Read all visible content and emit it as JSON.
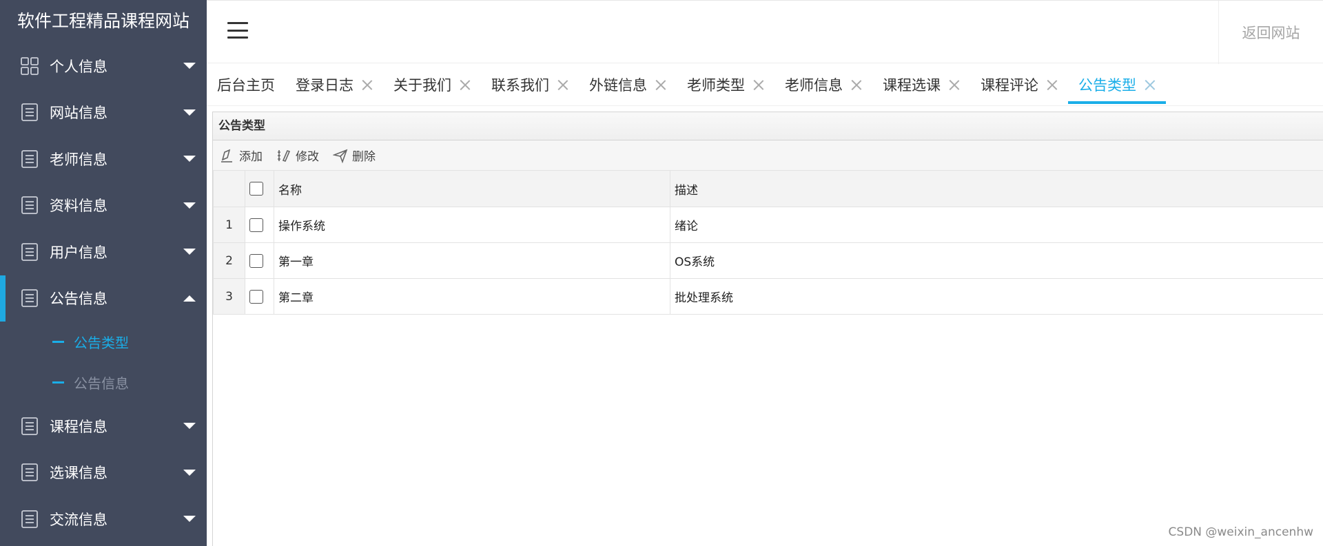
{
  "app": {
    "title": "软件工程精品课程网站"
  },
  "sidebar": {
    "items": [
      {
        "label": "个人信息",
        "icon": "grid-icon",
        "expanded": false
      },
      {
        "label": "网站信息",
        "icon": "list-icon",
        "expanded": false
      },
      {
        "label": "老师信息",
        "icon": "list-icon",
        "expanded": false
      },
      {
        "label": "资料信息",
        "icon": "list-icon",
        "expanded": false
      },
      {
        "label": "用户信息",
        "icon": "list-icon",
        "expanded": false
      },
      {
        "label": "公告信息",
        "icon": "list-icon",
        "expanded": true,
        "children": [
          {
            "label": "公告类型",
            "active": true
          },
          {
            "label": "公告信息",
            "active": false
          }
        ]
      },
      {
        "label": "课程信息",
        "icon": "list-icon",
        "expanded": false
      },
      {
        "label": "选课信息",
        "icon": "list-icon",
        "expanded": false
      },
      {
        "label": "交流信息",
        "icon": "list-icon",
        "expanded": false
      }
    ]
  },
  "header": {
    "back_label": "返回网站"
  },
  "tabs": [
    {
      "label": "后台主页",
      "closable": false
    },
    {
      "label": "登录日志",
      "closable": true
    },
    {
      "label": "关于我们",
      "closable": true
    },
    {
      "label": "联系我们",
      "closable": true
    },
    {
      "label": "外链信息",
      "closable": true
    },
    {
      "label": "老师类型",
      "closable": true
    },
    {
      "label": "老师信息",
      "closable": true
    },
    {
      "label": "课程选课",
      "closable": true
    },
    {
      "label": "课程评论",
      "closable": true
    },
    {
      "label": "公告类型",
      "closable": true,
      "active": true
    }
  ],
  "panel": {
    "title": "公告类型",
    "toolbar": {
      "add": "添加",
      "edit": "修改",
      "delete": "删除"
    },
    "columns": {
      "name": "名称",
      "desc": "描述"
    },
    "rows": [
      {
        "num": "1",
        "name": "操作系统",
        "desc": "绪论"
      },
      {
        "num": "2",
        "name": "第一章",
        "desc": "OS系统"
      },
      {
        "num": "3",
        "name": "第二章",
        "desc": "批处理系统"
      }
    ]
  },
  "watermark": "CSDN @weixin_ancenhw",
  "colors": {
    "sidebar_bg": "#424a5d",
    "accent": "#1aaee8"
  }
}
